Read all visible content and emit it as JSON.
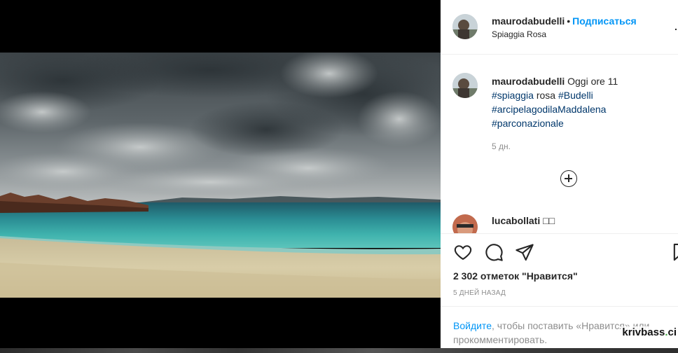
{
  "post": {
    "username": "maurodabudelli",
    "separator": "•",
    "follow_label": "Подписаться",
    "location": "Spiaggia Rosa",
    "header_cut_glyph": "."
  },
  "caption": {
    "username": "maurodabudelli",
    "text_prefix": "Oggi ore 11",
    "hashtag_1": "#spiaggia",
    "word_1": "rosa",
    "hashtag_2": "#Budelli",
    "hashtag_3": "#arcipelagodilaMaddalena",
    "hashtag_4": "#parconazionale",
    "age": "5 дн."
  },
  "comment": {
    "username": "lucabollati",
    "text": "□□"
  },
  "actions": {
    "like_icon": "heart-icon",
    "comment_icon": "comment-icon",
    "share_icon": "send-icon",
    "save_icon": "bookmark-icon"
  },
  "likes_text": "2 302 отметок \"Нравится\"",
  "time_ago": "5 дней назад",
  "login_prompt": {
    "link": "Войдите",
    "rest": ", чтобы поставить «Нравится» или прокомментировать."
  },
  "watermark": {
    "main": "krivbass",
    "dot": ".",
    "tail": "ci"
  },
  "colors": {
    "link_blue": "#0095f6",
    "hashtag_blue": "#00376b",
    "muted": "#8e8e8e",
    "text": "#262626"
  }
}
